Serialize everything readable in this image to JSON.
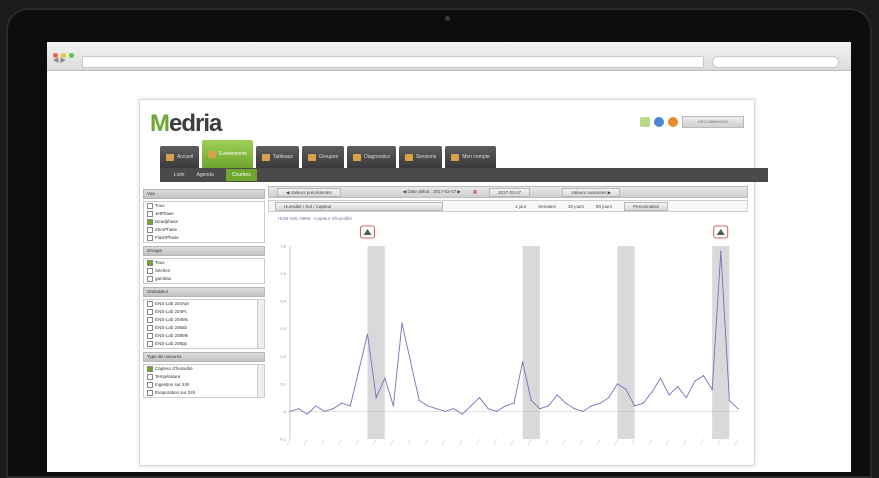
{
  "browser": {
    "back": "◀ ▶",
    "url": "",
    "search": ""
  },
  "app": {
    "logo_prefix": "M",
    "logo_rest": "edria",
    "user_menu": "DECONNEXION",
    "tabs": [
      {
        "label": "Accueil",
        "icon": "home-icon"
      },
      {
        "label": "Evénements",
        "icon": "events-icon"
      },
      {
        "label": "Tableaux",
        "icon": "table-icon"
      },
      {
        "label": "Groupes",
        "icon": "groups-icon"
      },
      {
        "label": "Diagnostics",
        "icon": "diagnostics-icon"
      },
      {
        "label": "Sessions",
        "icon": "sessions-icon"
      },
      {
        "label": "Mon compte",
        "icon": "account-icon"
      }
    ],
    "active_tab": 1,
    "subtabs": [
      "Liste",
      "Agenda",
      "Courbes"
    ],
    "active_subtab": 2
  },
  "sidebar": {
    "sections": [
      {
        "title": "Vue",
        "options": [
          {
            "label": "Tous",
            "checked": false
          },
          {
            "label": "JetPhase",
            "checked": false
          },
          {
            "label": "Deadphase",
            "checked": true
          },
          {
            "label": "ZeroPhase",
            "checked": false
          },
          {
            "label": "FlashPhase",
            "checked": false
          }
        ]
      },
      {
        "title": "Groupe",
        "options": [
          {
            "label": "Tous",
            "checked": true
          },
          {
            "label": "Sèches",
            "checked": false
          },
          {
            "label": "garnitas",
            "checked": false
          }
        ]
      },
      {
        "title": "Ordinateur",
        "options": [
          {
            "label": "ENS-Lab 204Apt",
            "checked": false
          },
          {
            "label": "ENS-Lab 204Pc",
            "checked": false
          },
          {
            "label": "ENS-Lab 204Mx",
            "checked": false
          },
          {
            "label": "ENS-Lab 208ab",
            "checked": false
          },
          {
            "label": "ENS-Lab 208Mk",
            "checked": false
          },
          {
            "label": "ENS-Lab 208pp",
            "checked": false
          }
        ]
      },
      {
        "title": "Type de mesures",
        "options": [
          {
            "label": "Capteur d'humidité",
            "checked": true
          },
          {
            "label": "Température",
            "checked": false
          },
          {
            "label": "Ingestion sur 24h",
            "checked": false
          },
          {
            "label": "Évaporation sur 24h",
            "checked": false
          }
        ]
      }
    ]
  },
  "controls": {
    "prev_period": "◀ Valeurs précédentes",
    "date_label": "◀ Date début : 2017-02-07 ▶",
    "date_end": "2017-02-07",
    "next_period": "Valeurs suivantes ▶",
    "measure": "Humidité / Sol / Capteur",
    "range_1": "1 jour",
    "range_2": "Semaine",
    "range_3": "30 jours",
    "range_4": "90 jours",
    "custom": "Personnalisé"
  },
  "chart_data": {
    "type": "line",
    "title": "HUM-SOL-0896 - Capteur d'humidité",
    "ylim": [
      -0.1,
      0.6
    ],
    "yticks": [
      "0.6",
      "0.5",
      "0.4",
      "0.3",
      "0.2",
      "0.1",
      "0",
      "-0.1"
    ],
    "grid": false,
    "series_color": "#7a70b8",
    "shaded_bands": [
      [
        9,
        11
      ],
      [
        27,
        29
      ],
      [
        38,
        40
      ],
      [
        49,
        51
      ]
    ],
    "alerts_at": [
      9,
      50
    ],
    "values": [
      0,
      0.01,
      -0.01,
      0.02,
      0,
      0.01,
      0.03,
      0.02,
      0.15,
      0.28,
      0.05,
      0.12,
      0.02,
      0.32,
      0.18,
      0.04,
      0.02,
      0.01,
      0,
      0.01,
      -0.01,
      0.02,
      0.05,
      0.01,
      0,
      0.02,
      0.03,
      0.18,
      0.04,
      0.01,
      0.02,
      0.06,
      0.03,
      0.01,
      0,
      0.02,
      0.03,
      0.05,
      0.1,
      0.08,
      0.02,
      0.03,
      0.07,
      0.12,
      0.06,
      0.09,
      0.05,
      0.11,
      0.13,
      0.08,
      0.58,
      0.04,
      0.01
    ]
  }
}
